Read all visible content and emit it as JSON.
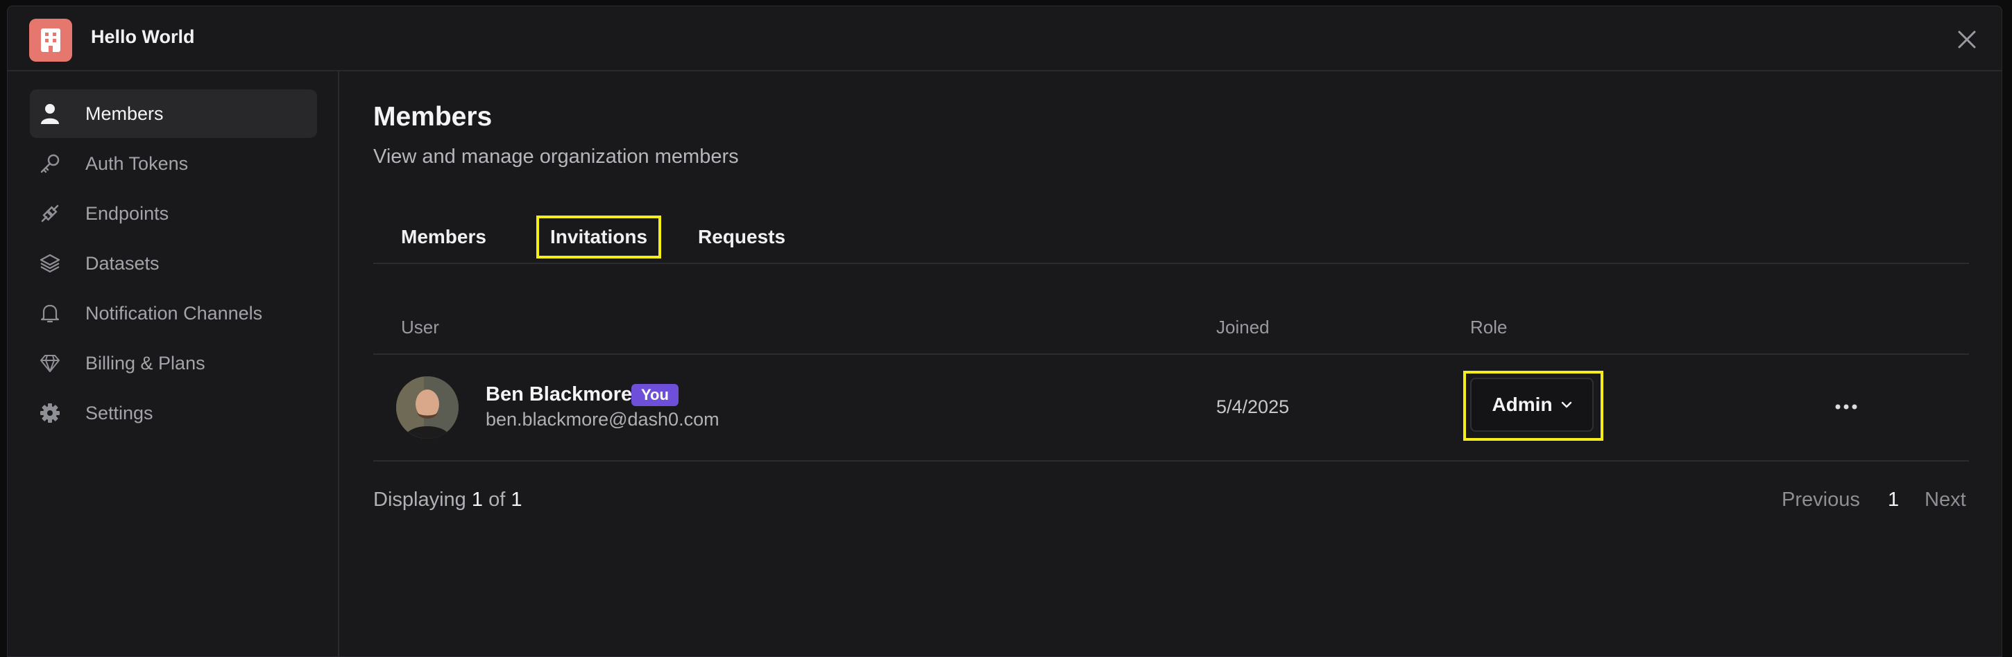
{
  "org": {
    "name": "Hello World",
    "avatar_icon": "building-icon",
    "avatar_color": "#e6776f"
  },
  "sidebar": {
    "items": [
      {
        "label": "Members",
        "icon": "person-icon",
        "active": true
      },
      {
        "label": "Auth Tokens",
        "icon": "key-icon"
      },
      {
        "label": "Endpoints",
        "icon": "plug-icon"
      },
      {
        "label": "Datasets",
        "icon": "layers-icon"
      },
      {
        "label": "Notification Channels",
        "icon": "bell-icon"
      },
      {
        "label": "Billing & Plans",
        "icon": "diamond-icon"
      },
      {
        "label": "Settings",
        "icon": "gear-icon"
      }
    ]
  },
  "page": {
    "title": "Members",
    "subtitle": "View and manage organization members",
    "tabs": [
      {
        "label": "Members"
      },
      {
        "label": "Invitations",
        "highlighted": true
      },
      {
        "label": "Requests"
      }
    ]
  },
  "table": {
    "columns": [
      "User",
      "Joined",
      "Role"
    ],
    "rows": [
      {
        "name": "Ben Blackmore",
        "badge": "You",
        "email": "ben.blackmore@dash0.com",
        "joined": "5/4/2025",
        "role": "Admin"
      }
    ]
  },
  "footer": {
    "displaying_prefix": "Displaying",
    "displaying_current": "1",
    "displaying_of": "of",
    "displaying_total": "1",
    "previous": "Previous",
    "page": "1",
    "next": "Next"
  },
  "colors": {
    "accent_badge": "#6e4fd9",
    "highlight": "#f5ee1a",
    "background": "#19191b"
  }
}
